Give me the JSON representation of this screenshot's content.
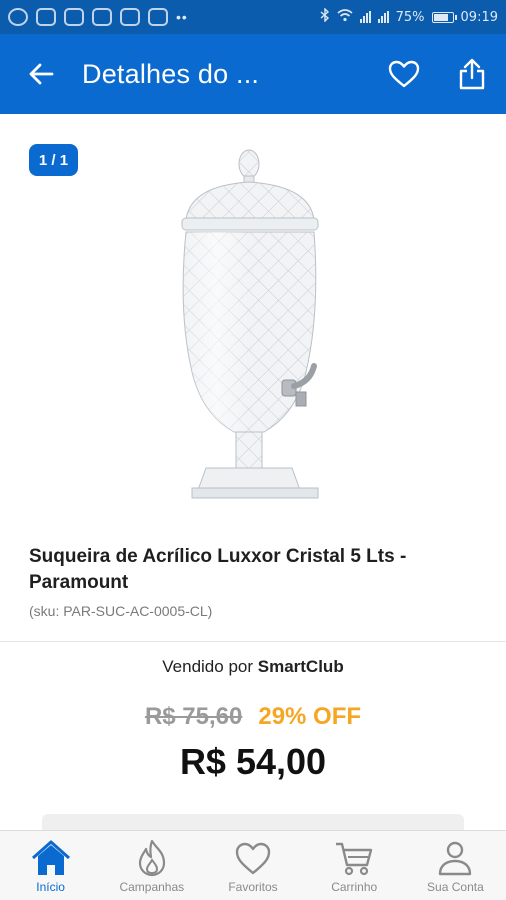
{
  "status_bar": {
    "battery": "75%",
    "time": "09:19"
  },
  "app_bar": {
    "title": "Detalhes do ..."
  },
  "gallery": {
    "counter": "1 / 1"
  },
  "product": {
    "title": "Suqueira de Acrílico Luxxor Cristal 5 Lts - Paramount",
    "sku": "(sku: PAR-SUC-AC-0005-CL)",
    "seller_prefix": "Vendido por",
    "seller_name": "SmartClub",
    "old_price": "R$ 75,60",
    "discount": "29% OFF",
    "price": "R$ 54,00"
  },
  "bottom_nav": {
    "items": [
      {
        "label": "Início",
        "icon": "home-icon",
        "active": true
      },
      {
        "label": "Campanhas",
        "icon": "flame-icon",
        "active": false
      },
      {
        "label": "Favoritos",
        "icon": "heart-icon",
        "active": false
      },
      {
        "label": "Carrinho",
        "icon": "cart-icon",
        "active": false
      },
      {
        "label": "Sua Conta",
        "icon": "user-icon",
        "active": false
      }
    ]
  },
  "colors": {
    "primary": "#0a6ad0",
    "status_bar": "#0b5cad",
    "discount": "#f5a623",
    "old_price": "#9a9a9a"
  }
}
